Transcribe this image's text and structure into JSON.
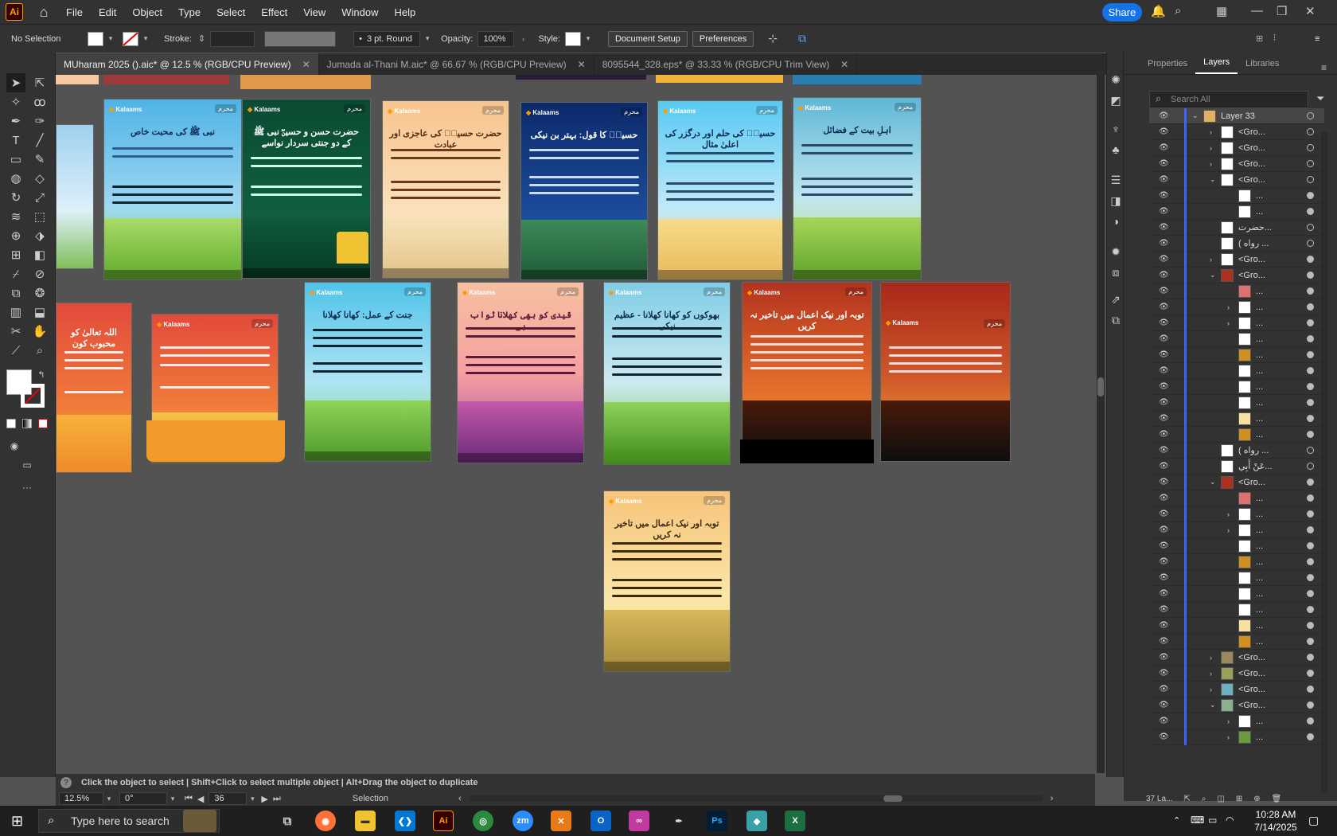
{
  "menu": {
    "app_logo": "Ai",
    "items": [
      "File",
      "Edit",
      "Object",
      "Type",
      "Select",
      "Effect",
      "View",
      "Window",
      "Help"
    ],
    "share_label": "Share"
  },
  "control_bar": {
    "selection": "No Selection",
    "stroke_label": "Stroke:",
    "brush_value": "3 pt. Round",
    "opacity_label": "Opacity:",
    "opacity_value": "100%",
    "style_label": "Style:",
    "document_setup": "Document Setup",
    "preferences": "Preferences"
  },
  "tabs": [
    {
      "label": "MUharam 2025 ().aic* @ 12.5 % (RGB/CPU Preview)"
    },
    {
      "label": "Jumada al-Thani M.aic* @ 66.67 % (RGB/CPU Preview)"
    },
    {
      "label": "8095544_328.eps* @ 33.33 % (RGB/CPU Trim View)"
    }
  ],
  "panel": {
    "tabs": [
      "Properties",
      "Layers",
      "Libraries"
    ],
    "search_placeholder": "Search All",
    "layers": [
      {
        "name": "Layer 33"
      },
      {
        "name": "<Gro..."
      },
      {
        "name": "<Gro..."
      },
      {
        "name": "<Gro..."
      },
      {
        "name": "<Gro..."
      },
      {
        "name": "..."
      },
      {
        "name": "..."
      },
      {
        "name": "حضرت..."
      },
      {
        "name": "( رواه ..."
      },
      {
        "name": "<Gro..."
      },
      {
        "name": "<Gro..."
      },
      {
        "name": "..."
      },
      {
        "name": "..."
      },
      {
        "name": "..."
      },
      {
        "name": "..."
      },
      {
        "name": "..."
      },
      {
        "name": "..."
      },
      {
        "name": "..."
      },
      {
        "name": "..."
      },
      {
        "name": "..."
      },
      {
        "name": "..."
      },
      {
        "name": "( رواه ..."
      },
      {
        "name": "عَنْ أَبِي..."
      },
      {
        "name": "<Gro..."
      },
      {
        "name": "..."
      },
      {
        "name": "..."
      },
      {
        "name": "..."
      },
      {
        "name": "..."
      },
      {
        "name": "..."
      },
      {
        "name": "..."
      },
      {
        "name": "..."
      },
      {
        "name": "..."
      },
      {
        "name": "..."
      },
      {
        "name": "..."
      },
      {
        "name": "<Gro..."
      },
      {
        "name": "<Gro..."
      },
      {
        "name": "<Gro..."
      },
      {
        "name": "<Gro..."
      },
      {
        "name": "..."
      },
      {
        "name": "..."
      }
    ],
    "layer_count": "37 La..."
  },
  "artboards": [
    {
      "brand": "Kalaams",
      "tag": "محرم",
      "title": "نبی ﷺ کی محبت خاص",
      "colors": [
        "#4fb3e6",
        "#8ed14f"
      ]
    },
    {
      "brand": "Kalaams",
      "tag": "محرم",
      "title": "حضرت حسن و حسینؓ نبی ﷺ کے دو جنتی سردار نواسے",
      "colors": [
        "#0b4a33",
        "#14613f"
      ]
    },
    {
      "brand": "Kalaams",
      "tag": "محرم",
      "title": "حضرت حسینؓ کی عاجزی اور عبادت",
      "colors": [
        "#f7c48e",
        "#f9e3b6"
      ]
    },
    {
      "brand": "Kalaams",
      "tag": "محرم",
      "title": "حسینؓ کا قول: بہتر بن نیکی",
      "colors": [
        "#0c2a6b",
        "#1d4fa0"
      ]
    },
    {
      "brand": "Kalaams",
      "tag": "محرم",
      "title": "حسینؓ کی حلم اور درگزر کی اعلیٰ مثال",
      "colors": [
        "#57c9f2",
        "#f3d27a"
      ]
    },
    {
      "brand": "Kalaams",
      "tag": "محرم",
      "title": "اہلِ بیت کے فضائل",
      "colors": [
        "#5fb7d6",
        "#c9e06c"
      ]
    },
    {
      "brand": "Kalaams",
      "tag": "محرم",
      "title": "اللہ تعالیٰ کو محبوب کون",
      "colors": [
        "#e24a3b",
        "#f6a43a"
      ]
    },
    {
      "brand": "Kalaams",
      "tag": "محرم",
      "title": "",
      "colors": [
        "#e24a3b",
        "#f6a43a"
      ]
    },
    {
      "brand": "Kalaams",
      "tag": "محرم",
      "title": "جنت کے عمل: کھانا کھلانا",
      "colors": [
        "#4fc3e8",
        "#7fcf6a"
      ]
    },
    {
      "brand": "Kalaams",
      "tag": "محرم",
      "title": "قیدی کو بھی کھلانا ثواب ہے",
      "colors": [
        "#f6a0a0",
        "#a24aa8"
      ]
    },
    {
      "brand": "Kalaams",
      "tag": "محرم",
      "title": "بھوکوں کو کھانا کھلانا - عظیم نیکی",
      "colors": [
        "#7fcde6",
        "#6fbf3a"
      ]
    },
    {
      "brand": "Kalaams",
      "tag": "محرم",
      "title": "توبہ اور نیک اعمال میں تاخیر نہ کریں",
      "colors": [
        "#b3331f",
        "#f49a2a"
      ]
    },
    {
      "brand": "Kalaams",
      "tag": "محرم",
      "title": "",
      "colors": [
        "#a8281a",
        "#f6b23a"
      ]
    },
    {
      "brand": "Kalaams",
      "tag": "محرم",
      "title": "توبہ اور نیک اعمال میں تاخیر نہ کریں",
      "colors": [
        "#f7c47a",
        "#f3e27a"
      ]
    }
  ],
  "status": {
    "help_text": "Click the object to select  |  Shift+Click to select multiple object  |  Alt+Drag the object to duplicate",
    "zoom": "12.5%",
    "rotation": "0°",
    "artboard_num": "36",
    "mode": "Selection"
  },
  "taskbar": {
    "search_placeholder": "Type here to search",
    "time": "10:28 AM",
    "date": "7/14/2025",
    "apps": [
      "Ai",
      "Ps",
      "zm"
    ]
  }
}
